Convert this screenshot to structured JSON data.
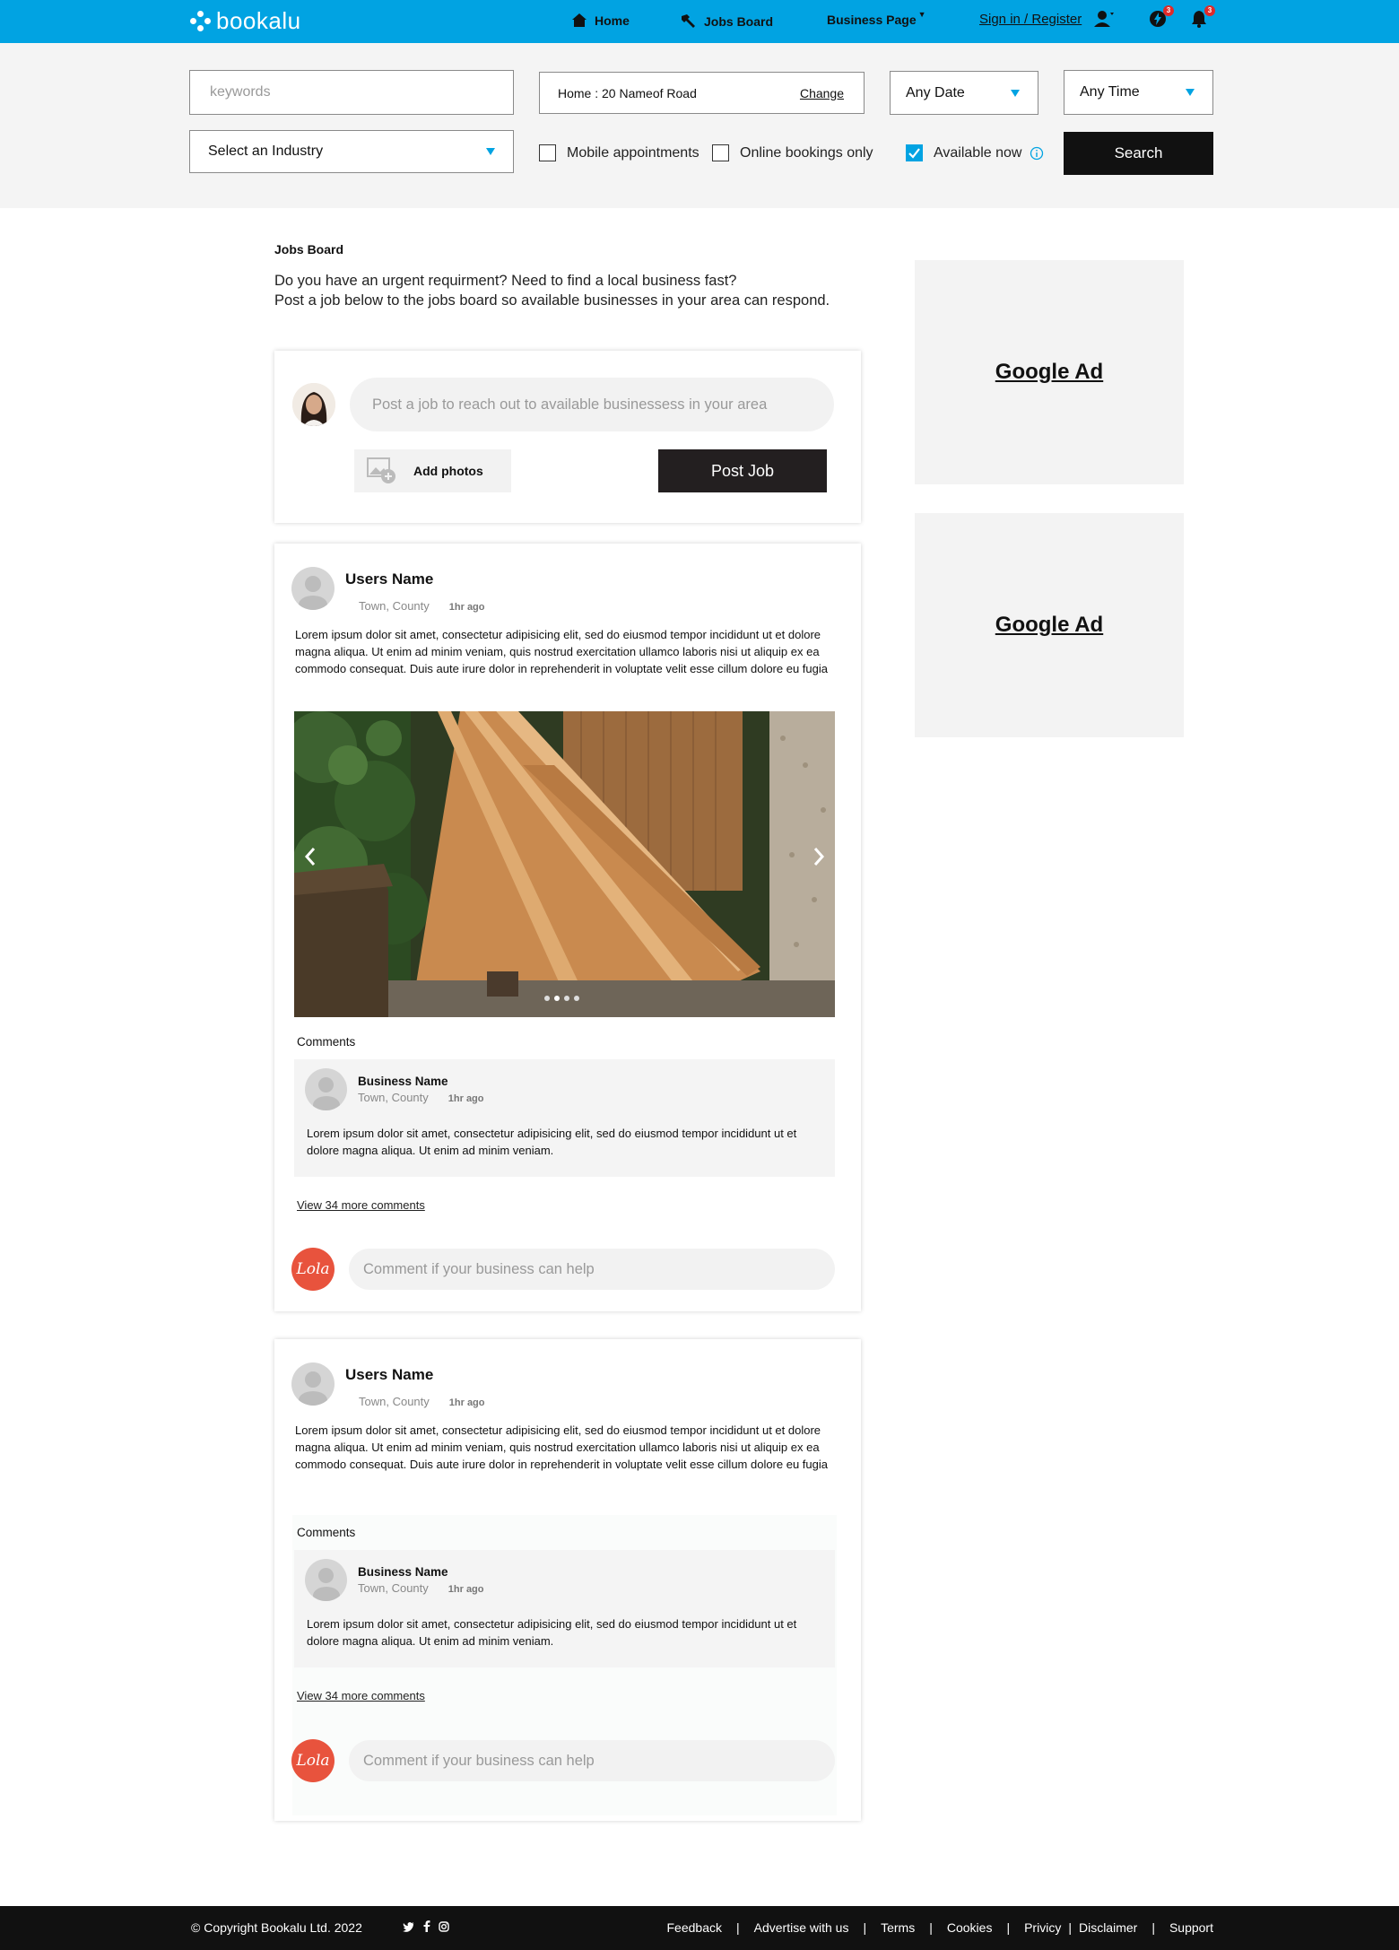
{
  "nav": {
    "logo": "bookalu",
    "home": "Home",
    "jobs_board": "Jobs Board",
    "business_page": "Business Page",
    "sign_in": "Sign in / Register",
    "messages_badge": "3",
    "notifications_badge": "3"
  },
  "search": {
    "keywords_placeholder": "keywords",
    "location_value": "Home : 20 Nameof Road",
    "change_label": "Change",
    "date_value": "Any Date",
    "time_value": "Any Time",
    "industry_value": "Select an Industry",
    "mobile_label": "Mobile appointments",
    "mobile_checked": false,
    "online_label": "Online bookings only",
    "online_checked": false,
    "available_label": "Available now",
    "available_checked": true,
    "search_label": "Search",
    "accent_color": "#01a3e2"
  },
  "main": {
    "title": "Jobs Board",
    "intro_line1": "Do you have an urgent requirment? Need to find a local business fast?",
    "intro_line2": "Post a job below to the jobs board so available businesses in your area can respond."
  },
  "composer": {
    "placeholder": "Post a job to reach out to available businessess in your area",
    "add_photos": "Add photos",
    "post_job": "Post Job"
  },
  "posts": [
    {
      "user_name": "Users Name",
      "location": "Town, County",
      "time": "1hr ago",
      "body": "Lorem ipsum dolor sit amet, consectetur adipisicing elit, sed do eiusmod tempor incididunt ut et dolore magna aliqua. Ut enim ad minim veniam, quis nostrud exercitation ullamco laboris nisi ut aliquip ex ea commodo consequat. Duis aute irure dolor in reprehenderit in voluptate velit esse cillum dolore eu fugia",
      "comments_label": "Comments",
      "comment": {
        "business_name": "Business Name",
        "location": "Town, County",
        "time": "1hr ago",
        "body": "Lorem ipsum dolor sit amet, consectetur adipisicing elit, sed do eiusmod tempor incididunt ut et dolore magna aliqua. Ut enim ad minim veniam."
      },
      "view_more": "View 34 more comments",
      "comment_placeholder": "Comment if your business can help",
      "commenter_badge": "Lola"
    },
    {
      "user_name": "Users Name",
      "location": "Town, County",
      "time": "1hr ago",
      "body": "Lorem ipsum dolor sit amet, consectetur adipisicing elit, sed do eiusmod tempor incididunt ut et dolore magna aliqua. Ut enim ad minim veniam, quis nostrud exercitation ullamco laboris nisi ut aliquip ex ea commodo consequat. Duis aute irure dolor in reprehenderit in voluptate velit esse cillum dolore eu fugia",
      "comments_label": "Comments",
      "comment": {
        "business_name": "Business Name",
        "location": "Town, County",
        "time": "1hr ago",
        "body": "Lorem ipsum dolor sit amet, consectetur adipisicing elit, sed do eiusmod tempor incididunt ut et dolore magna aliqua. Ut enim ad minim veniam."
      },
      "view_more": "View 34 more comments",
      "comment_placeholder": "Comment if your business can help",
      "commenter_badge": "Lola"
    }
  ],
  "ads": [
    "Google Ad",
    "Google Ad"
  ],
  "footer": {
    "copyright": "© Copyright Bookalu Ltd. 2022",
    "links": [
      "Feedback",
      "Advertise with us",
      "Terms",
      "Cookies",
      "Privicy",
      "Disclaimer",
      "Support"
    ],
    "separator": "|"
  }
}
